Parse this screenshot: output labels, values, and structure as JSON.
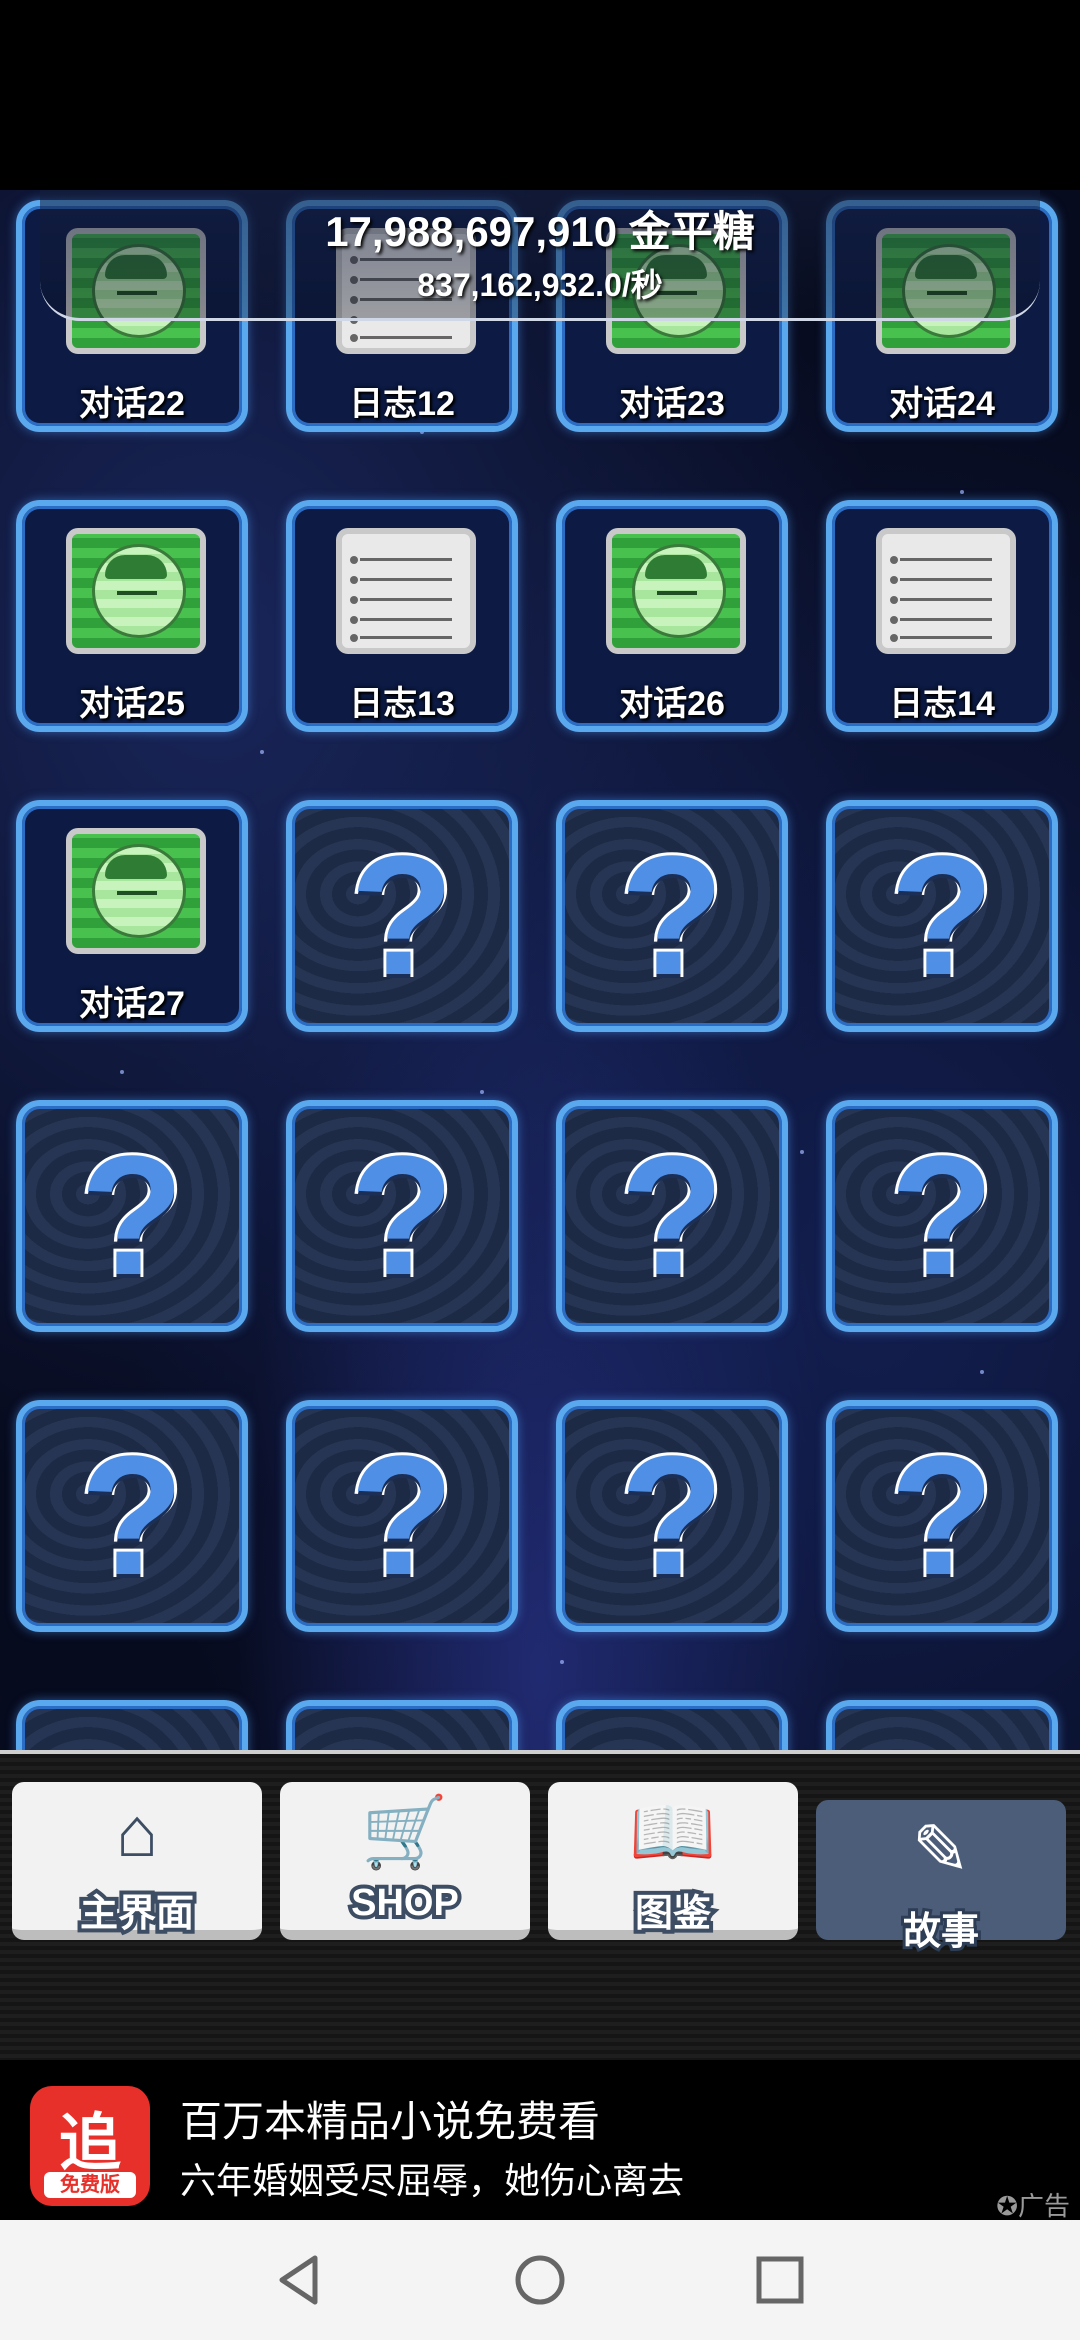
{
  "counter": {
    "total": "17,988,697,910 金平糖",
    "rate": "837,162,932.0/秒"
  },
  "tiles": [
    {
      "kind": "chat",
      "label": "对话22"
    },
    {
      "kind": "log",
      "label": "日志12"
    },
    {
      "kind": "chat",
      "label": "对话23"
    },
    {
      "kind": "chat",
      "label": "对话24"
    },
    {
      "kind": "chat",
      "label": "对话25"
    },
    {
      "kind": "log",
      "label": "日志13"
    },
    {
      "kind": "chat",
      "label": "对话26"
    },
    {
      "kind": "log",
      "label": "日志14"
    },
    {
      "kind": "chat",
      "label": "对话27"
    },
    {
      "kind": "locked",
      "label": "?"
    },
    {
      "kind": "locked",
      "label": "?"
    },
    {
      "kind": "locked",
      "label": "?"
    },
    {
      "kind": "locked",
      "label": "?"
    },
    {
      "kind": "locked",
      "label": "?"
    },
    {
      "kind": "locked",
      "label": "?"
    },
    {
      "kind": "locked",
      "label": "?"
    },
    {
      "kind": "locked",
      "label": "?"
    },
    {
      "kind": "locked",
      "label": "?"
    },
    {
      "kind": "locked",
      "label": "?"
    },
    {
      "kind": "locked",
      "label": "?"
    }
  ],
  "nav": {
    "home": {
      "label": "主界面",
      "icon": "house-icon"
    },
    "shop": {
      "label": "SHOP",
      "icon": "cart-icon"
    },
    "collection": {
      "label": "图鉴",
      "icon": "book-icon"
    },
    "story": {
      "label": "故事",
      "icon": "book-quill-icon",
      "active": true
    }
  },
  "ad": {
    "app_glyph": "追",
    "app_badge": "免费版",
    "title": "百万本精品小说免费看",
    "subtitle": "六年婚姻受尽屈辱，她伤心离去",
    "tag": "✪广告"
  },
  "colors": {
    "tile_border": "#5aa9ee",
    "question_mark": "#4f8fe6",
    "active_nav": "#4b5d78",
    "ad_icon": "#e8302b"
  }
}
